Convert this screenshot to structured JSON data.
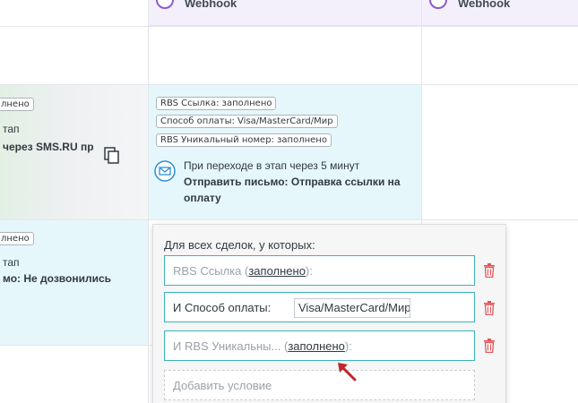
{
  "columns": [
    {
      "title": "Webhook"
    },
    {
      "title": "Webhook"
    }
  ],
  "left_card_1": {
    "tag": "лнено",
    "line1": "тап",
    "line2": "через SMS.RU пр"
  },
  "left_card_2": {
    "tag": "лнено",
    "line1": "тап",
    "line2": "мо: Не дозвонились"
  },
  "trigger_card": {
    "tags": [
      "RBS Ссылка: заполнено",
      "Способ оплаты: Visa/MasterCard/Мир",
      "RBS Уникальный номер: заполнено"
    ],
    "timing": "При переходе в этап через 5 минут",
    "action_line1": "Отправить письмо: Отправка ссылки на",
    "action_line2": "оплату"
  },
  "popup": {
    "heading": "Для всех сделок, у которых:",
    "conditions": [
      {
        "field": "RBS Ссылка",
        "value": "заполнено"
      },
      {
        "field": "И Способ оплаты:",
        "value": "Visa/MasterCard/Мир"
      },
      {
        "field": "И RBS Уникальны...",
        "value": "заполнено"
      }
    ],
    "add_condition": "Добавить условие"
  },
  "colors": {
    "accent": "#3bb3b9",
    "header_bg": "#f4f0fb",
    "trash": "#e25656",
    "arrow": "#c0262d",
    "card_bg": "#e6f7fb"
  }
}
